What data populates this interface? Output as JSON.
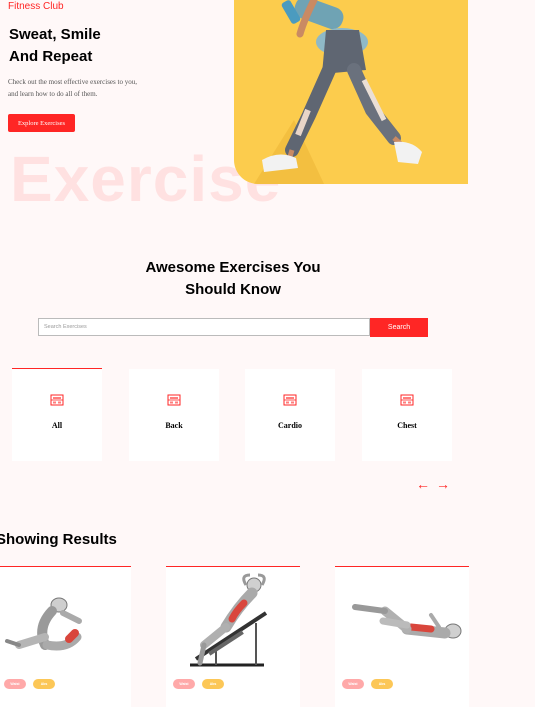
{
  "hero": {
    "brand": "Fitness Club",
    "title_line1": "Sweat, Smile",
    "title_line2": "And Repeat",
    "subtitle_line1": "Check out the most effective exercises to you,",
    "subtitle_line2": "and learn how to do all of them.",
    "cta": "Explore Exercises",
    "watermark": "Exercise"
  },
  "section": {
    "title_line1": "Awesome Exercises You",
    "title_line2": "Should Know"
  },
  "search": {
    "placeholder": "Search Exercises",
    "button": "Search"
  },
  "categories": [
    {
      "label": "All",
      "icon": "gym-icon"
    },
    {
      "label": "Back",
      "icon": "gym-icon"
    },
    {
      "label": "Cardio",
      "icon": "gym-icon"
    },
    {
      "label": "Chest",
      "icon": "gym-icon"
    }
  ],
  "nav": {
    "prev": "←",
    "next": "→"
  },
  "results": {
    "title": "Showing Results",
    "cards": [
      {
        "badges": [
          "Waist",
          "Abs"
        ]
      },
      {
        "badges": [
          "Waist",
          "Abs"
        ]
      },
      {
        "badges": [
          "Waist",
          "Abs"
        ]
      }
    ]
  },
  "colors": {
    "accent": "#ff2625",
    "hero_bg": "#fccc4d",
    "badge_pink": "#ffa9a9",
    "badge_yellow": "#fcc757"
  }
}
